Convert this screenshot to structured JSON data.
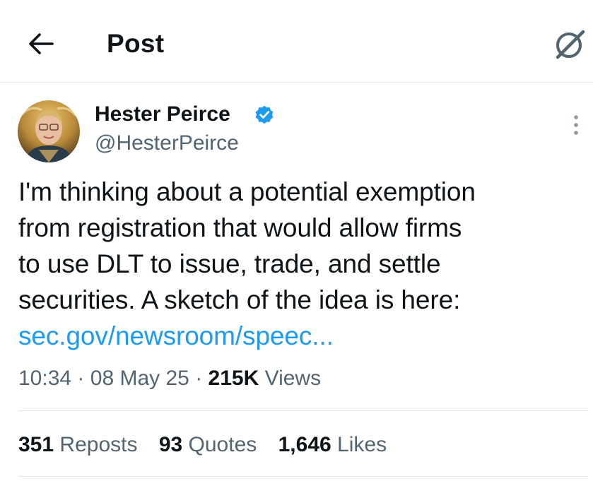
{
  "header": {
    "title": "Post",
    "back_icon": "arrow-left-icon",
    "grok_icon": "grok-icon"
  },
  "author": {
    "name": "Hester Peirce",
    "handle": "@HesterPeirce",
    "verified": true,
    "verified_color": "#1d9bf0"
  },
  "tweet": {
    "lines": [
      "I'm thinking about a potential exemption",
      "from registration that would allow firms",
      "to use DLT to issue, trade, and settle",
      "securities. A sketch of the idea is here:"
    ],
    "link_text": "sec.gov/newsroom/speec..."
  },
  "meta": {
    "time": "10:34",
    "separator": "·",
    "date": "08 May 25",
    "views_count": "215K",
    "views_label": "Views"
  },
  "stats": [
    {
      "count": "351",
      "label": "Reposts"
    },
    {
      "count": "93",
      "label": "Quotes"
    },
    {
      "count": "1,646",
      "label": "Likes"
    }
  ],
  "colors": {
    "accent": "#1d9bf0",
    "text_primary": "#0f1419",
    "text_secondary": "#536471",
    "divider": "#e3e6e8"
  }
}
